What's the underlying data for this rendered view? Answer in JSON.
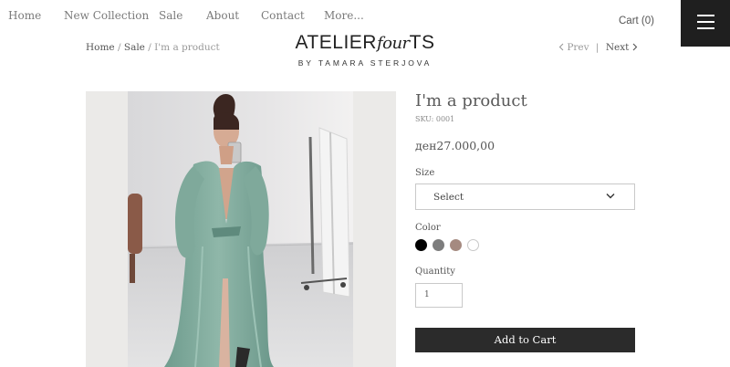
{
  "nav": {
    "items": [
      "Home",
      "New Collection",
      "Sale",
      "About",
      "Contact",
      "More..."
    ],
    "cart_label": "Cart (0)",
    "menu_icon": "hamburger-icon"
  },
  "brand": {
    "main_prefix": "ATELIER",
    "main_script": "four",
    "main_suffix": "TS",
    "tagline": "BY TAMARA STERJOVA"
  },
  "breadcrumb": {
    "home": "Home",
    "sep1": " / ",
    "sale": "Sale",
    "sep2": " / ",
    "current": "I'm a product"
  },
  "pager": {
    "prev_icon": "chevron-left-icon",
    "prev": "Prev",
    "divider": "|",
    "next": "Next",
    "next_icon": "chevron-right-icon"
  },
  "product": {
    "title": "I'm a product",
    "sku": "SKU: 0001",
    "price": "ден27.000,00",
    "size_label": "Size",
    "size_value": "Select",
    "color_label": "Color",
    "colors": [
      "#000000",
      "#7d7d7d",
      "#a58a80",
      "#ffffff"
    ],
    "quantity_label": "Quantity",
    "quantity_value": "1",
    "add_to_cart": "Add to Cart"
  }
}
